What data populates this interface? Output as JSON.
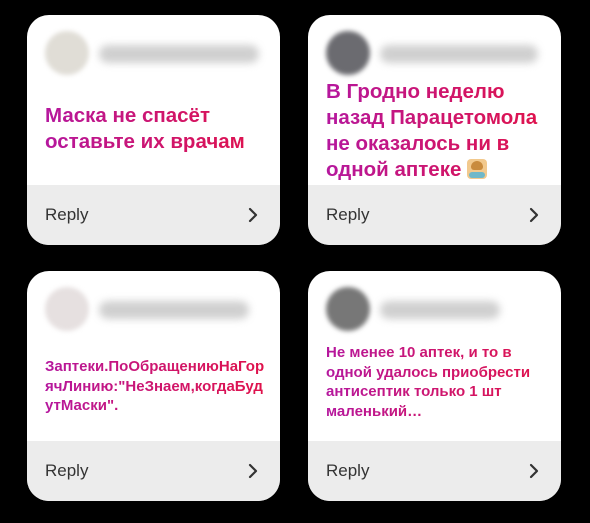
{
  "cards": [
    {
      "message": "Маска не спасёт оставьте их врачам",
      "reply_label": "Reply",
      "author_hint": ""
    },
    {
      "message": "В Гродно неделю назад Парацетомола не оказалось ни в одной аптеке",
      "emoji": "person-shrugging-emoji",
      "reply_label": "Reply",
      "author_hint": "v"
    },
    {
      "message": "Заптеки.ПоОбращениюНаГорячЛинию:\"НеЗнаем,когдаБудутМаски\".",
      "reply_label": "Reply"
    },
    {
      "message": "Не менее 10 аптек, и то в одной удалось приобрести антисептик только 1 шт маленький…",
      "reply_label": "Reply"
    }
  ],
  "icons": {
    "reply_chevron": "chevron-right-icon"
  },
  "colors": {
    "background": "#000000",
    "card": "#ffffff",
    "reply_bar": "#ececec",
    "message_gradient_start": "#b5179e",
    "message_gradient_end": "#e0124a"
  }
}
